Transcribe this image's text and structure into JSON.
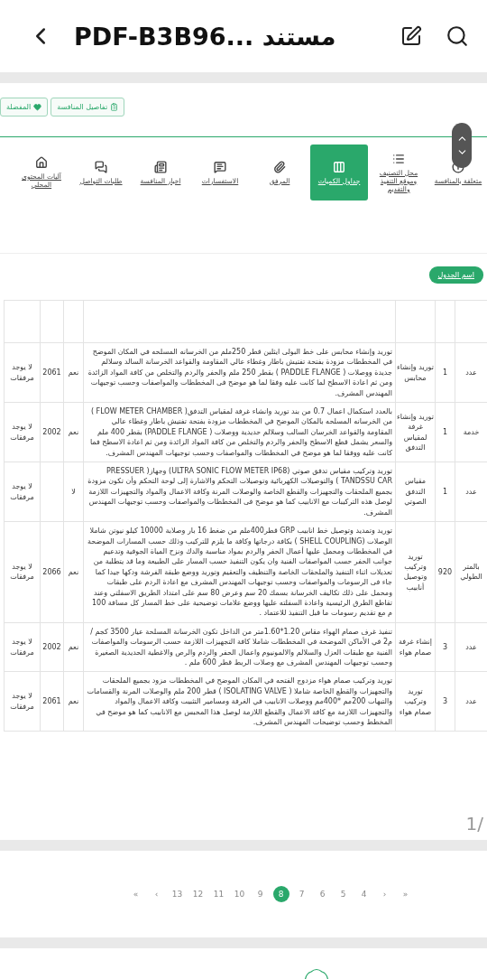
{
  "app_bar": {
    "title": "PDF-B3B96... مستند"
  },
  "page_1": {
    "action_buttons": [
      {
        "label": "تفاصيل المنافسة",
        "kind": "clipboard"
      },
      {
        "label": "المفضلة",
        "kind": "heart"
      }
    ],
    "tabs": [
      {
        "label": "متعلقة بالمنافسة",
        "kind": "info",
        "selected": false
      },
      {
        "label": "محل التصنيف وموقع التنفيذ والتقديم",
        "kind": "list",
        "selected": false
      },
      {
        "label": "جداول الكميات",
        "kind": "table",
        "selected": true
      },
      {
        "label": "المرفق",
        "kind": "clip",
        "selected": false
      },
      {
        "label": "الاستفسارات",
        "kind": "chat",
        "selected": false
      },
      {
        "label": "اخبار المنافسة",
        "kind": "news",
        "selected": false
      },
      {
        "label": "طلبات التواصل",
        "kind": "forum",
        "selected": false
      },
      {
        "label": "آليات المحتوى المحلي",
        "kind": "home",
        "selected": false
      }
    ],
    "table_button": "اسم الجدول",
    "table": {
      "rows": [
        {
          "column_1": "عدد",
          "column_2": "1",
          "column_3": "توريد وإنشاء محابس",
          "column_4": "توريد وإنشاء محابس على خط البولى ايثلين قطر 250ملم من الخرسانه المسلحه في المكان الموضح في المخططات مزودة بفتحة تفتيش باطار وغطاء عالي المقاومة والقواعد الخرسانة السالد وسلالم جديدة ووصلات ( PADDLE FLANGE ) بقطر 250 ملم والحفر والردم والتخلص من كافة المواد الزائدة ومن ثم اعادة الاسطح لما كانت عليه وفقا لما هو موضح فى المخططات والمواصفات وحسب توجيهات المهندس المشرف.",
          "column_5": "نعم",
          "column_6": "2061",
          "column_7": "لا يوجد مرفقات"
        },
        {
          "column_1": "خدمة",
          "column_2": "1",
          "column_3": "توريد وإنشاء غرفة لمقياس التدفق",
          "column_4": "بالعدد استكمال اعمال 0.7 من بند توريد وانشاء غرفة لمقياس التدفق( FLOW METER CHAMBER ) من الخرسانه المسلحه بالمكان الموضح في المخططات مزودة بفتحة تفتيش باطار وغطاء عالي المقاومة والقواعد الخرسان السالب وسلالم حديدية ووصلات ( PADDLE FLANGE) بقطر 400 ملم والسعر يشمل قطع الاسطح والحفر والردم والتخلص من كافة المواد الزائدة ومن ثم اعادة الاسطح فما كانت عليه ووفقا لما هو موضح في المخططات والمواصفات وحسب توجيهات المهندس المشرف.",
          "column_5": "نعم",
          "column_6": "2002",
          "column_7": "لا يوجد مرفقات"
        },
        {
          "column_1": "عدد",
          "column_2": "1",
          "column_3": "مقياس التدفق الصوتي",
          "column_4": "توريد وتركيب مقياس تدفق صوتي (ULTRA SONIC FLOW METER IP68) وجهاز( PRESSUER TANDSSU CAR ) والتوصيلات الكهربائية وتوصيلات التحكم والاشارة إلى لوحة التحكم وأن تكون مزودة بجميع الملحقات والتجهيزات والقطع الخاصة والوصلات المرنة وكافة الاعمال والمواد والتجهيزات اللازمة لوصل هذه التركيبات مع الانابيب كما هو موضح فى المخططات والمواصفات وحسب توجيهات المهندس المشرف.",
          "column_5": "لا",
          "column_7": "لا يوجد مرفقات"
        },
        {
          "column_1": "بالمتر الطولي",
          "column_2": "920",
          "column_3": "توريد وتركيب وتوصيل أنابيب",
          "column_4": "توريد وتمديد وتوصيل خط انابيب GRP قطر400ملم من ضغط 16 بار وصلابة 10000 كيلو نيوتن شاملا الوصلات (SHELL COUPLING ) بكافة درجاتها وكافة ما يلزم للتركيب وذلك حسب المسارات الموضحة في المخططات ومحمل عليها أعمال الحفر والردم بمواد مناسبة والدك ونزح المياة الجوفية وتدعيم جوانب الحفر حسب المواصفات الفنية وان يكون التنفيذ حسب المسار على الطبيعة وما قد يتطلبة من تعديلات اثناء التنفيذ والملحقات الخاصة والتنظيف والتعقيم وتوريد ووضع طبقة الفرشة ودكها جيدا كما جاء فى الرسومات والمواصفات وحسب توجيهات المهندس المشرف مع اعادة الردم على طبقات ومحمل على ذلك تكاليف الخرسانة بسمك 20 سم وعرض 80 سم على امتداد الطريق الاسفلتي وعند تقاطع الطرق الرئيسية واعادة السفلته عليها ووضع علامات توضيحية على خط المسار كل مسافة 100 م مع تقديم رسومات ما قبل التنفيذ للاعتماد .",
          "column_5": "نعم",
          "column_6": "2066",
          "column_7": "لا يوجد مرفقات"
        },
        {
          "column_1": "عدد",
          "column_2": "3",
          "column_3": "إنشاء غرفة صمام هواء",
          "column_4": "تنفيذ غرف صمام الهواء مقاس 1.20*1.60متر من الداخل تكون الخرسانة المسلحة عيار 3500 كجم / م2 في الأماكن الموضحة في المخططات شاملا كافة التجهيزات اللازمة حسب الرسومات والمواصفات الفنية مع طبقات العزل والسلالم والالمونيوم واعمال الحفر والردم والرص والاغطية الحديدية الصغيرة وحسب توجيهات المهندس المشرف مع وصلات الربط قطر 600 ملم .",
          "column_5": "نعم",
          "column_6": "2002",
          "column_7": "لا يوجد مرفقات"
        },
        {
          "column_1": "عدد",
          "column_2": "3",
          "column_3": "توريد وتركيب صمام هواء",
          "column_4": "توريد وتركيب صمام هواء مزدوج الفتحه في المكان الموضح في المخططات مزود بجميع الملحقات والتجهيزات والقطع الخاصة شاملا ( ISOLATING VALVE ) قطر 200 ملم والوصلات المرنة والقسامات والتبهات 200مم *400مم ووصلات الانابيب في الغرفة ومسامير التثبيت وكافة الاعمال والمواد والتجهيزات اللازمة مع كافة الاعمال والقطع اللازمة لوصل هذا المحبس مع الانابيب كما هو موضح في المخطط وحسب توضيحات المهندس المشرف.",
          "column_5": "نعم",
          "column_6": "2061",
          "column_7": "لا يوجد مرفقات"
        }
      ]
    },
    "page_number": "1/"
  },
  "page_2": {
    "pagination": [
      {
        "label": "»",
        "selected": false
      },
      {
        "label": "›",
        "selected": false
      },
      {
        "label": "4",
        "selected": false
      },
      {
        "label": "5",
        "selected": false
      },
      {
        "label": "6",
        "selected": false
      },
      {
        "label": "7",
        "selected": false
      },
      {
        "label": "8",
        "selected": true
      },
      {
        "label": "9",
        "selected": false
      },
      {
        "label": "10",
        "selected": false
      },
      {
        "label": "11",
        "selected": false
      },
      {
        "label": "12",
        "selected": false
      },
      {
        "label": "13",
        "selected": false
      },
      {
        "label": "‹",
        "selected": false
      },
      {
        "label": "«",
        "selected": false
      }
    ]
  }
}
